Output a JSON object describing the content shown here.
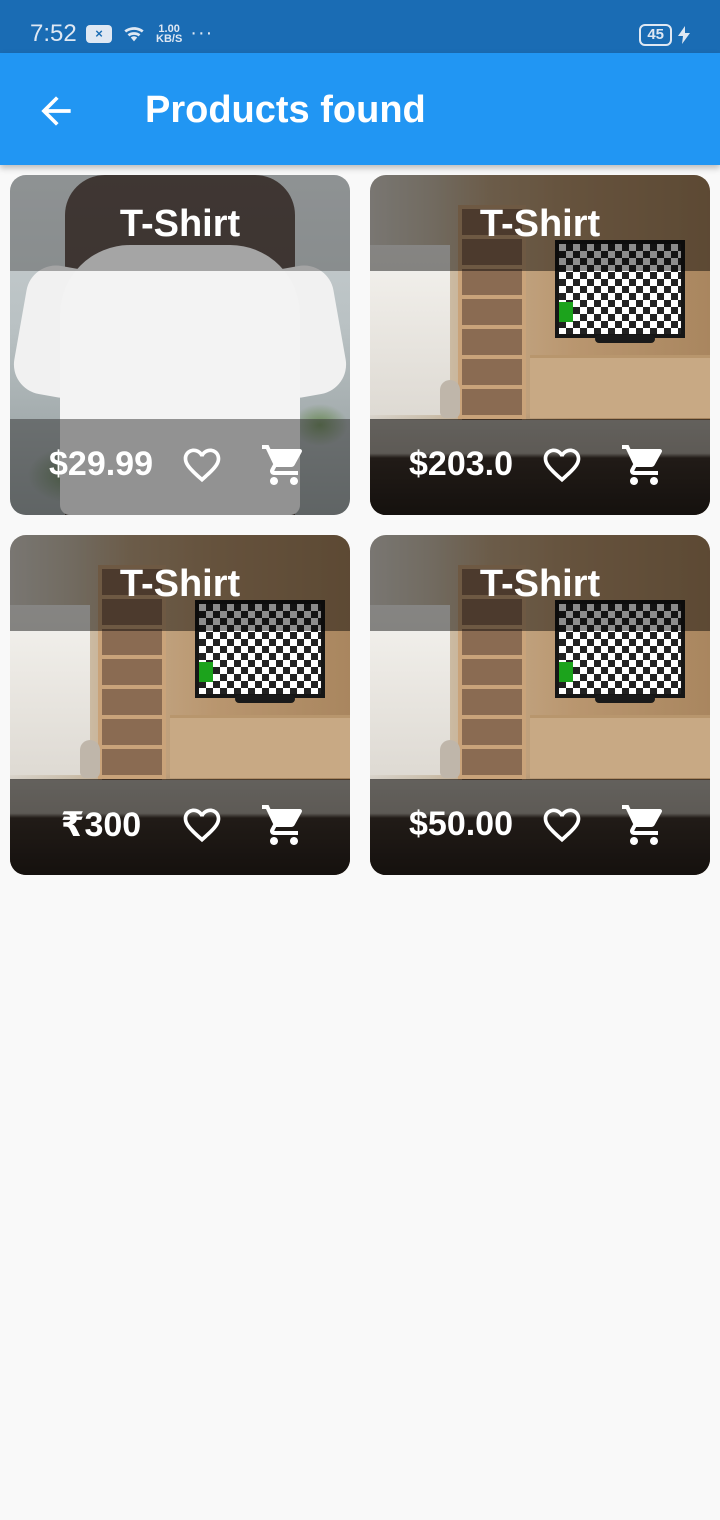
{
  "status_bar": {
    "time": "7:52",
    "notif_label": "×",
    "net_speed_value": "1.00",
    "net_speed_unit": "KB/S",
    "more": "···",
    "battery": "45"
  },
  "app_bar": {
    "back_icon": "arrow-back-icon",
    "title": "Products found"
  },
  "products": [
    {
      "title": "T-Shirt",
      "price": "$29.99",
      "image": "tshirt"
    },
    {
      "title": "T-Shirt",
      "price": "$203.0",
      "image": "room"
    },
    {
      "title": "T-Shirt",
      "price": "₹300",
      "image": "room"
    },
    {
      "title": "T-Shirt",
      "price": "$50.00",
      "image": "room"
    }
  ],
  "colors": {
    "status_bar": "#1a6cb4",
    "app_bar": "#2196f3",
    "background": "#f9f9f9",
    "overlay_text": "#ffffff"
  },
  "icons": {
    "favorite": "heart-outline-icon",
    "cart": "shopping-cart-icon"
  }
}
